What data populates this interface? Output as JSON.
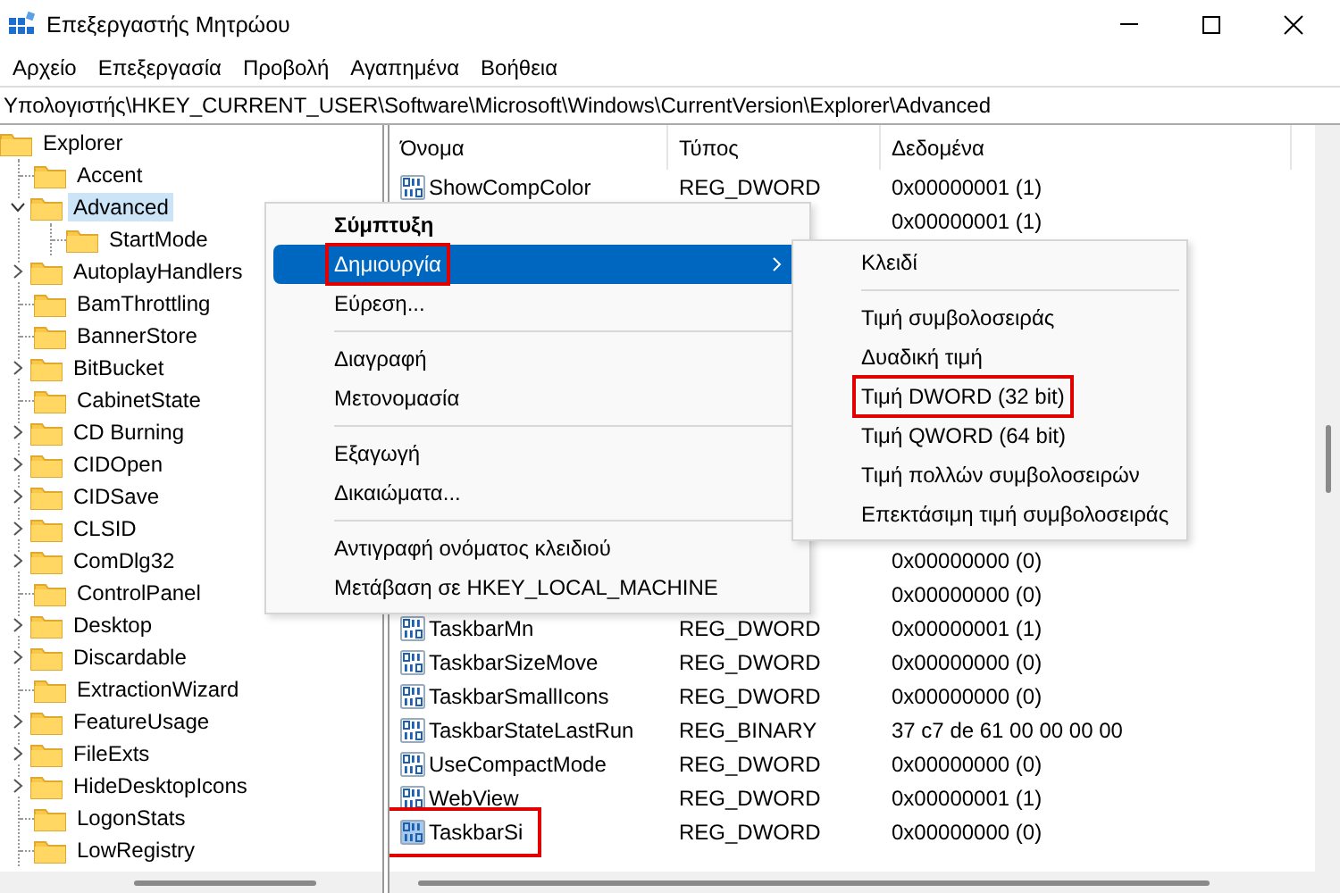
{
  "window": {
    "title": "Επεξεργαστής Μητρώου"
  },
  "menu_bar": [
    "Αρχείο",
    "Επεξεργασία",
    "Προβολή",
    "Αγαπημένα",
    "Βοήθεια"
  ],
  "address": "Υπολογιστής\\HKEY_CURRENT_USER\\Software\\Microsoft\\Windows\\CurrentVersion\\Explorer\\Advanced",
  "tree": {
    "items": [
      {
        "label": "Explorer",
        "selected": false,
        "children": [
          {
            "label": "Accent",
            "kind": "leaf",
            "selected": false
          },
          {
            "label": "Advanced",
            "kind": "expanded",
            "selected": true,
            "children": [
              {
                "label": "StartMode",
                "kind": "leaf",
                "selected": false
              }
            ]
          },
          {
            "label": "AutoplayHandlers",
            "kind": "collapsed",
            "selected": false
          },
          {
            "label": "BamThrottling",
            "kind": "leaf",
            "selected": false
          },
          {
            "label": "BannerStore",
            "kind": "leaf",
            "selected": false
          },
          {
            "label": "BitBucket",
            "kind": "collapsed",
            "selected": false
          },
          {
            "label": "CabinetState",
            "kind": "leaf",
            "selected": false
          },
          {
            "label": "CD Burning",
            "kind": "collapsed",
            "selected": false
          },
          {
            "label": "CIDOpen",
            "kind": "collapsed",
            "selected": false
          },
          {
            "label": "CIDSave",
            "kind": "collapsed",
            "selected": false
          },
          {
            "label": "CLSID",
            "kind": "collapsed",
            "selected": false
          },
          {
            "label": "ComDlg32",
            "kind": "collapsed",
            "selected": false
          },
          {
            "label": "ControlPanel",
            "kind": "leaf",
            "selected": false
          },
          {
            "label": "Desktop",
            "kind": "collapsed",
            "selected": false
          },
          {
            "label": "Discardable",
            "kind": "collapsed",
            "selected": false
          },
          {
            "label": "ExtractionWizard",
            "kind": "leaf",
            "selected": false
          },
          {
            "label": "FeatureUsage",
            "kind": "collapsed",
            "selected": false
          },
          {
            "label": "FileExts",
            "kind": "collapsed",
            "selected": false
          },
          {
            "label": "HideDesktopIcons",
            "kind": "collapsed",
            "selected": false
          },
          {
            "label": "LogonStats",
            "kind": "leaf",
            "selected": false
          },
          {
            "label": "LowRegistry",
            "kind": "leaf",
            "selected": false
          }
        ]
      }
    ]
  },
  "table": {
    "columns": [
      "Όνομα",
      "Τύπος",
      "Δεδομένα"
    ],
    "rows_top": [
      {
        "name": "ShowCompColor",
        "type": "REG_DWORD",
        "data": "0x00000001 (1)",
        "selected": false,
        "outlined": false
      },
      {
        "data": "0x00000001 (1)",
        "selected": false,
        "outlined": false
      }
    ],
    "rows_bottom": [
      {
        "data": "0x00000000 (0)",
        "selected": false,
        "outlined": false
      },
      {
        "data": "0x00000000 (0)",
        "selected": false,
        "outlined": false
      },
      {
        "name": "TaskbarMn",
        "type": "REG_DWORD",
        "data": "0x00000001 (1)",
        "selected": false,
        "outlined": false
      },
      {
        "name": "TaskbarSizeMove",
        "type": "REG_DWORD",
        "data": "0x00000000 (0)",
        "selected": false,
        "outlined": false
      },
      {
        "name": "TaskbarSmallIcons",
        "type": "REG_DWORD",
        "data": "0x00000000 (0)",
        "selected": false,
        "outlined": false
      },
      {
        "name": "TaskbarStateLastRun",
        "type": "REG_BINARY",
        "data": "37 c7 de 61 00 00 00 00",
        "selected": false,
        "outlined": false
      },
      {
        "name": "UseCompactMode",
        "type": "REG_DWORD",
        "data": "0x00000000 (0)",
        "selected": false,
        "outlined": false
      },
      {
        "name": "WebView",
        "type": "REG_DWORD",
        "data": "0x00000001 (1)",
        "selected": false,
        "outlined": false
      },
      {
        "name": "TaskbarSi",
        "type": "REG_DWORD",
        "data": "0x00000000 (0)",
        "selected": true,
        "outlined": true
      }
    ]
  },
  "context_menu": [
    {
      "kind": "item",
      "label": "Σύμπτυξη",
      "bold": true,
      "selected": false,
      "outlined": false,
      "submenu": false
    },
    {
      "kind": "item",
      "label": "Δημιουργία",
      "bold": false,
      "selected": true,
      "outlined": true,
      "submenu": true
    },
    {
      "kind": "item",
      "label": "Εύρεση...",
      "bold": false,
      "selected": false,
      "outlined": false,
      "submenu": false
    },
    {
      "kind": "separator"
    },
    {
      "kind": "item",
      "label": "Διαγραφή",
      "bold": false,
      "selected": false,
      "outlined": false,
      "submenu": false
    },
    {
      "kind": "item",
      "label": "Μετονομασία",
      "bold": false,
      "selected": false,
      "outlined": false,
      "submenu": false
    },
    {
      "kind": "separator"
    },
    {
      "kind": "item",
      "label": "Εξαγωγή",
      "bold": false,
      "selected": false,
      "outlined": false,
      "submenu": false
    },
    {
      "kind": "item",
      "label": "Δικαιώματα...",
      "bold": false,
      "selected": false,
      "outlined": false,
      "submenu": false
    },
    {
      "kind": "separator"
    },
    {
      "kind": "item",
      "label": "Αντιγραφή ονόματος κλειδιού",
      "bold": false,
      "selected": false,
      "outlined": false,
      "submenu": false
    },
    {
      "kind": "item",
      "label": "Μετάβαση σε HKEY_LOCAL_MACHINE",
      "bold": false,
      "selected": false,
      "outlined": false,
      "submenu": false
    }
  ],
  "submenu": [
    {
      "kind": "item",
      "label": "Κλειδί",
      "bold": false,
      "selected": false,
      "outlined": false,
      "submenu": false
    },
    {
      "kind": "separator"
    },
    {
      "kind": "item",
      "label": "Τιμή συμβολοσειράς",
      "bold": false,
      "selected": false,
      "outlined": false,
      "submenu": false
    },
    {
      "kind": "item",
      "label": "Δυαδική τιμή",
      "bold": false,
      "selected": false,
      "outlined": false,
      "submenu": false
    },
    {
      "kind": "item",
      "label": "Τιμή DWORD (32 bit)",
      "bold": false,
      "selected": false,
      "outlined": true,
      "submenu": false
    },
    {
      "kind": "item",
      "label": "Τιμή QWORD (64 bit)",
      "bold": false,
      "selected": false,
      "outlined": false,
      "submenu": false
    },
    {
      "kind": "item",
      "label": "Τιμή πολλών συμβολοσειρών",
      "bold": false,
      "selected": false,
      "outlined": false,
      "submenu": false
    },
    {
      "kind": "item",
      "label": "Επεκτάσιμη τιμή συμβολοσειράς",
      "bold": false,
      "selected": false,
      "outlined": false,
      "submenu": false
    }
  ]
}
